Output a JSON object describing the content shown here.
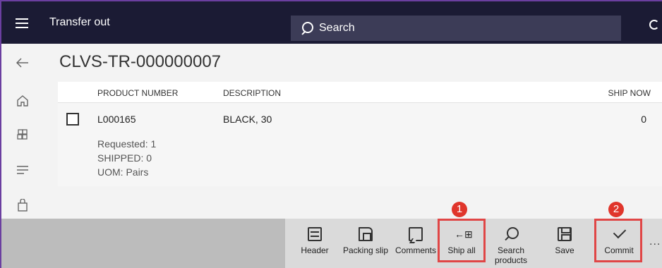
{
  "app": {
    "title": "Transfer out"
  },
  "search": {
    "placeholder": "Search"
  },
  "page": {
    "title": "CLVS-TR-000000007"
  },
  "grid": {
    "columns": [
      "PRODUCT NUMBER",
      "DESCRIPTION",
      "SHIP NOW"
    ],
    "rows": [
      {
        "product_number": "L000165",
        "description": "BLACK, 30",
        "ship_now": "0",
        "requested": "Requested: 1",
        "shipped": "SHIPPED: 0",
        "uom": "UOM: Pairs"
      }
    ]
  },
  "rail": {
    "count": "0"
  },
  "actions": {
    "header": "Header",
    "packing_slip": "Packing slip",
    "comments": "Comments",
    "ship_all": "Ship all",
    "search_products": "Search products",
    "save": "Save",
    "commit": "Commit",
    "more": "..."
  },
  "badges": [
    "1",
    "2"
  ],
  "colors": {
    "topbar": "#1b1b34",
    "search": "#3c3c57",
    "highlight": "#e04646",
    "badge": "#e0352b"
  },
  "icons": [
    "hamburger-icon",
    "search-icon",
    "refresh-icon",
    "back-arrow-icon",
    "home-icon",
    "modules-icon",
    "list-icon",
    "shopping-bag-icon",
    "header-icon",
    "packing-slip-icon",
    "comments-icon",
    "ship-all-icon",
    "search-products-icon",
    "save-icon",
    "commit-check-icon"
  ]
}
